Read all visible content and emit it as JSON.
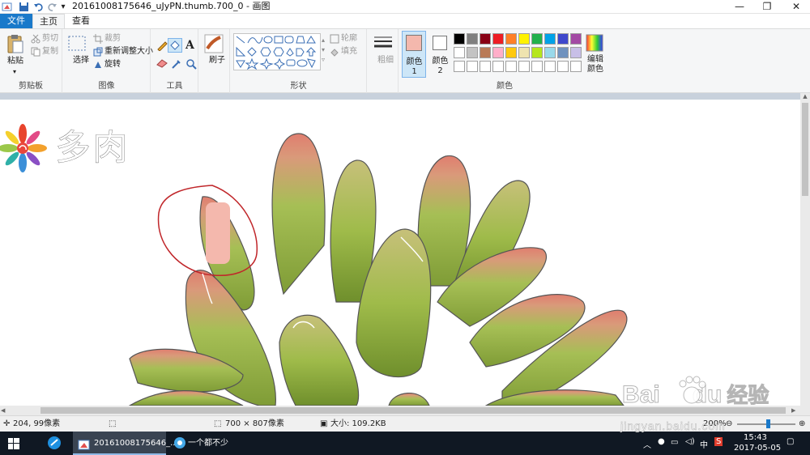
{
  "titlebar": {
    "title": "20161008175646_uJyPN.thumb.700_0 - 画图",
    "minimize": "—",
    "maximize": "❐",
    "close": "✕"
  },
  "tabs": {
    "file": "文件",
    "home": "主页",
    "view": "查看"
  },
  "ribbon": {
    "clipboard": {
      "paste": "粘贴",
      "cut": "剪切",
      "copy": "复制",
      "label": "剪贴板"
    },
    "image": {
      "select": "选择",
      "crop": "裁剪",
      "resize": "重新调整大小",
      "rotate": "旋转",
      "label": "图像"
    },
    "tools": {
      "label": "工具"
    },
    "brushes": {
      "label": "刷子"
    },
    "shapes": {
      "outline": "轮廓",
      "fill": "填充",
      "label": "形状"
    },
    "size": {
      "label": "粗细"
    },
    "color1": {
      "label": "颜色 1",
      "value": "#f4b8ad"
    },
    "color2": {
      "label": "颜色 2",
      "value": "#ffffff"
    },
    "colors": {
      "label": "颜色",
      "edit": "编辑颜色",
      "row1": [
        "#000000",
        "#7f7f7f",
        "#880015",
        "#ed1c24",
        "#ff7f27",
        "#fff200",
        "#22b14c",
        "#00a2e8",
        "#3f48cc",
        "#a349a4"
      ],
      "row2": [
        "#ffffff",
        "#c3c3c3",
        "#b97a57",
        "#ffaec9",
        "#ffc90e",
        "#efe4b0",
        "#b5e61d",
        "#99d9ea",
        "#7092be",
        "#c8bfe7"
      ],
      "row3": [
        "#ffffff",
        "#ffffff",
        "#ffffff",
        "#ffffff",
        "#ffffff",
        "#ffffff",
        "#ffffff",
        "#ffffff",
        "#ffffff",
        "#ffffff"
      ]
    }
  },
  "canvas": {
    "heading": "多肉"
  },
  "status": {
    "cursor": "204, 99像素",
    "image_size": "700 × 807像素",
    "file_size": "大小: 109.2KB",
    "zoom": "200%"
  },
  "taskbar": {
    "app1": "20161008175646_...",
    "app2": "一个都不少",
    "ime": "中",
    "time": "15:43",
    "date": "2017-05-05"
  },
  "watermark": {
    "brand": "Bai",
    "brand2": "du",
    "cn": "经验",
    "url": "jingyan.baidu.com"
  }
}
